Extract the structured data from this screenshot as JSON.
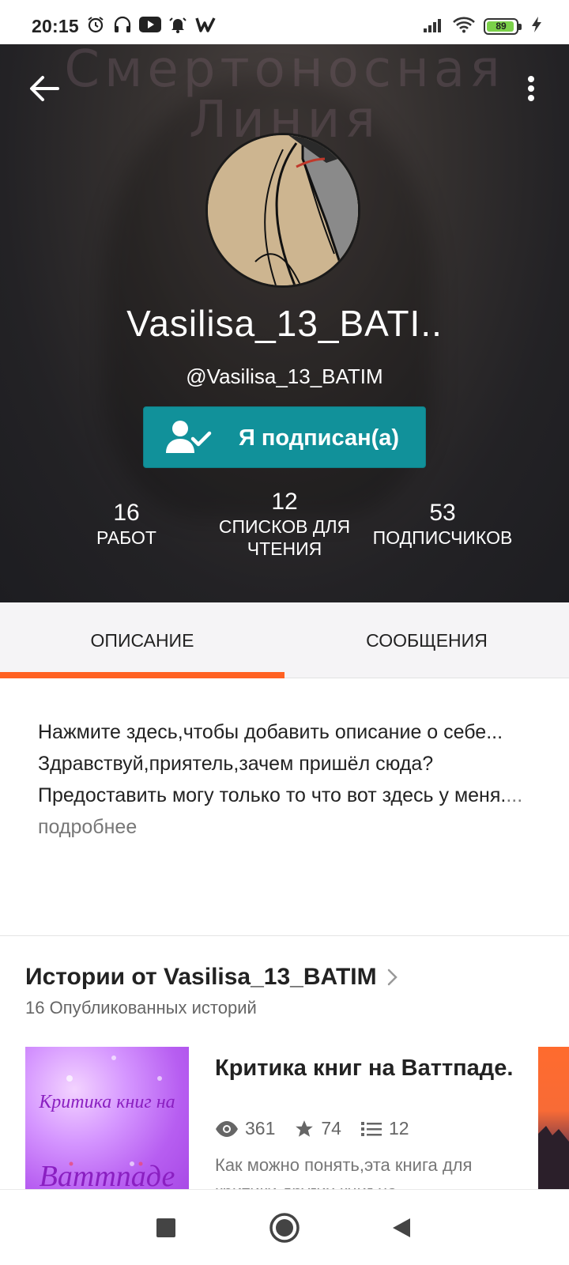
{
  "status_bar": {
    "time": "20:15",
    "battery": "89",
    "icons": [
      "alarm-icon",
      "headphones-icon",
      "youtube-icon",
      "alarm-bell-icon",
      "wattpad-icon",
      "signal-icon",
      "wifi-icon",
      "battery-icon",
      "charging-icon"
    ]
  },
  "header": {
    "background_text": "Смертоносная Линия",
    "display_name": "Vasilisa_13_BATI..",
    "handle": "@Vasilisa_13_BATIM",
    "follow_button": "Я подписан(а)",
    "stats": [
      {
        "value": "16",
        "label": "РАБОТ"
      },
      {
        "value": "12",
        "label": "СПИСКОВ ДЛЯ ЧТЕНИЯ"
      },
      {
        "value": "53",
        "label": "ПОДПИСЧИКОВ"
      }
    ]
  },
  "tabs": [
    {
      "label": "ОПИСАНИЕ",
      "active": true
    },
    {
      "label": "СООБЩЕНИЯ",
      "active": false
    }
  ],
  "description": {
    "text": "Нажмите здесь,чтобы добавить описание о себе...\nЗдравствуй,приятель,зачем пришёл сюда? Предоставить могу только то что вот здесь у меня.",
    "more_link": "... подробнее"
  },
  "stories": {
    "title": "Истории от Vasilisa_13_BATIM",
    "subtitle": "16 Опубликованных историй",
    "items": [
      {
        "cover_text_top": "Критика книг на",
        "cover_text_bottom": "Ваттпаде",
        "title": "Критика книг на Ваттпаде.",
        "views": "361",
        "votes": "74",
        "parts": "12",
        "description": "Как можно понять,эта книга для критики других книг на"
      }
    ]
  },
  "colors": {
    "accent_teal": "#11919a",
    "accent_orange": "#ff6122",
    "cover_purple": "#b75ef1"
  }
}
